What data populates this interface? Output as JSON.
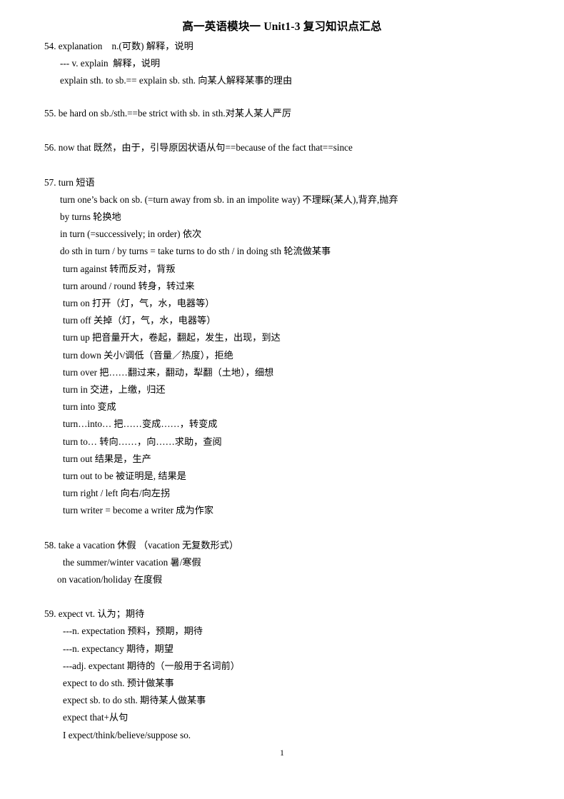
{
  "document": {
    "title": "高一英语模块一 Unit1-3 复习知识点汇总",
    "page_number": "1"
  },
  "entries": [
    {
      "number": "54",
      "lines": [
        {
          "indent": 0,
          "text": "54. explanation    n.(可数) 解释，说明"
        },
        {
          "indent": 1,
          "text": "--- v. explain  解释，说明"
        },
        {
          "indent": 1,
          "text": "explain sth. to sb.== explain sb. sth. 向某人解释某事的理由"
        }
      ]
    },
    {
      "number": "55",
      "lines": [
        {
          "indent": 0,
          "text": "55. be hard on sb./sth.==be strict with sb. in sth.对某人某人严厉"
        }
      ]
    },
    {
      "number": "56",
      "lines": [
        {
          "indent": 0,
          "text": "56. now that 既然，由于，引导原因状语从句==because of the fact that==since"
        }
      ]
    },
    {
      "number": "57",
      "lines": [
        {
          "indent": 0,
          "text": "57. turn 短语"
        },
        {
          "indent": 1,
          "text": "turn one’s back on sb. (=turn away from sb. in an impolite way) 不理睬(某人),背弃,抛弃"
        },
        {
          "indent": 1,
          "text": "by turns 轮换地"
        },
        {
          "indent": 1,
          "text": "in turn (=successively; in order) 依次"
        },
        {
          "indent": 1,
          "text": "do sth in turn / by turns = take turns to do sth / in doing sth 轮流做某事"
        },
        {
          "indent": 2,
          "text": "turn against 转而反对，背叛"
        },
        {
          "indent": 2,
          "text": "turn around / round 转身，转过来"
        },
        {
          "indent": 2,
          "text": "turn on 打开（灯，气，水，电器等）"
        },
        {
          "indent": 2,
          "text": "turn off 关掉（灯，气，水，电器等）"
        },
        {
          "indent": 2,
          "text": "turn up 把音量开大，卷起，翻起，发生，出现，到达"
        },
        {
          "indent": 2,
          "text": "turn down 关小/调低（音量／热度），拒绝"
        },
        {
          "indent": 2,
          "text": "turn over 把……翻过来，翻动，犁翻（土地），细想"
        },
        {
          "indent": 2,
          "text": "turn in 交进，上缴，归还"
        },
        {
          "indent": 2,
          "text": "turn into 变成"
        },
        {
          "indent": 2,
          "text": "turn…into… 把……变成……，转变成"
        },
        {
          "indent": 2,
          "text": "turn to… 转向……，向……求助，查阅"
        },
        {
          "indent": 2,
          "text": "turn out 结果是，生产"
        },
        {
          "indent": 2,
          "text": "turn out to be 被证明是, 结果是"
        },
        {
          "indent": 2,
          "text": "turn right / left 向右/向左拐"
        },
        {
          "indent": 2,
          "text": "turn writer = become a writer 成为作家"
        }
      ]
    },
    {
      "number": "58",
      "lines": [
        {
          "indent": 0,
          "text": "58. take a vacation 休假 （vacation 无复数形式）"
        },
        {
          "indent": 2,
          "text": "the summer/winter vacation 暑/寒假"
        },
        {
          "indent": 1,
          "text": "on vacation/holiday 在度假"
        }
      ]
    },
    {
      "number": "59",
      "lines": [
        {
          "indent": 0,
          "text": "59. expect vt. 认为；期待"
        },
        {
          "indent": 2,
          "text": "---n. expectation 预料，预期，期待"
        },
        {
          "indent": 2,
          "text": "---n. expectancy 期待，期望"
        },
        {
          "indent": 2,
          "text": "---adj. expectant 期待的（一般用于名词前）"
        },
        {
          "indent": 2,
          "text": "expect to do sth. 预计做某事"
        },
        {
          "indent": 2,
          "text": "expect sb. to do sth. 期待某人做某事"
        },
        {
          "indent": 2,
          "text": "expect that+从句"
        },
        {
          "indent": 2,
          "text": "I expect/think/believe/suppose so."
        }
      ]
    }
  ]
}
